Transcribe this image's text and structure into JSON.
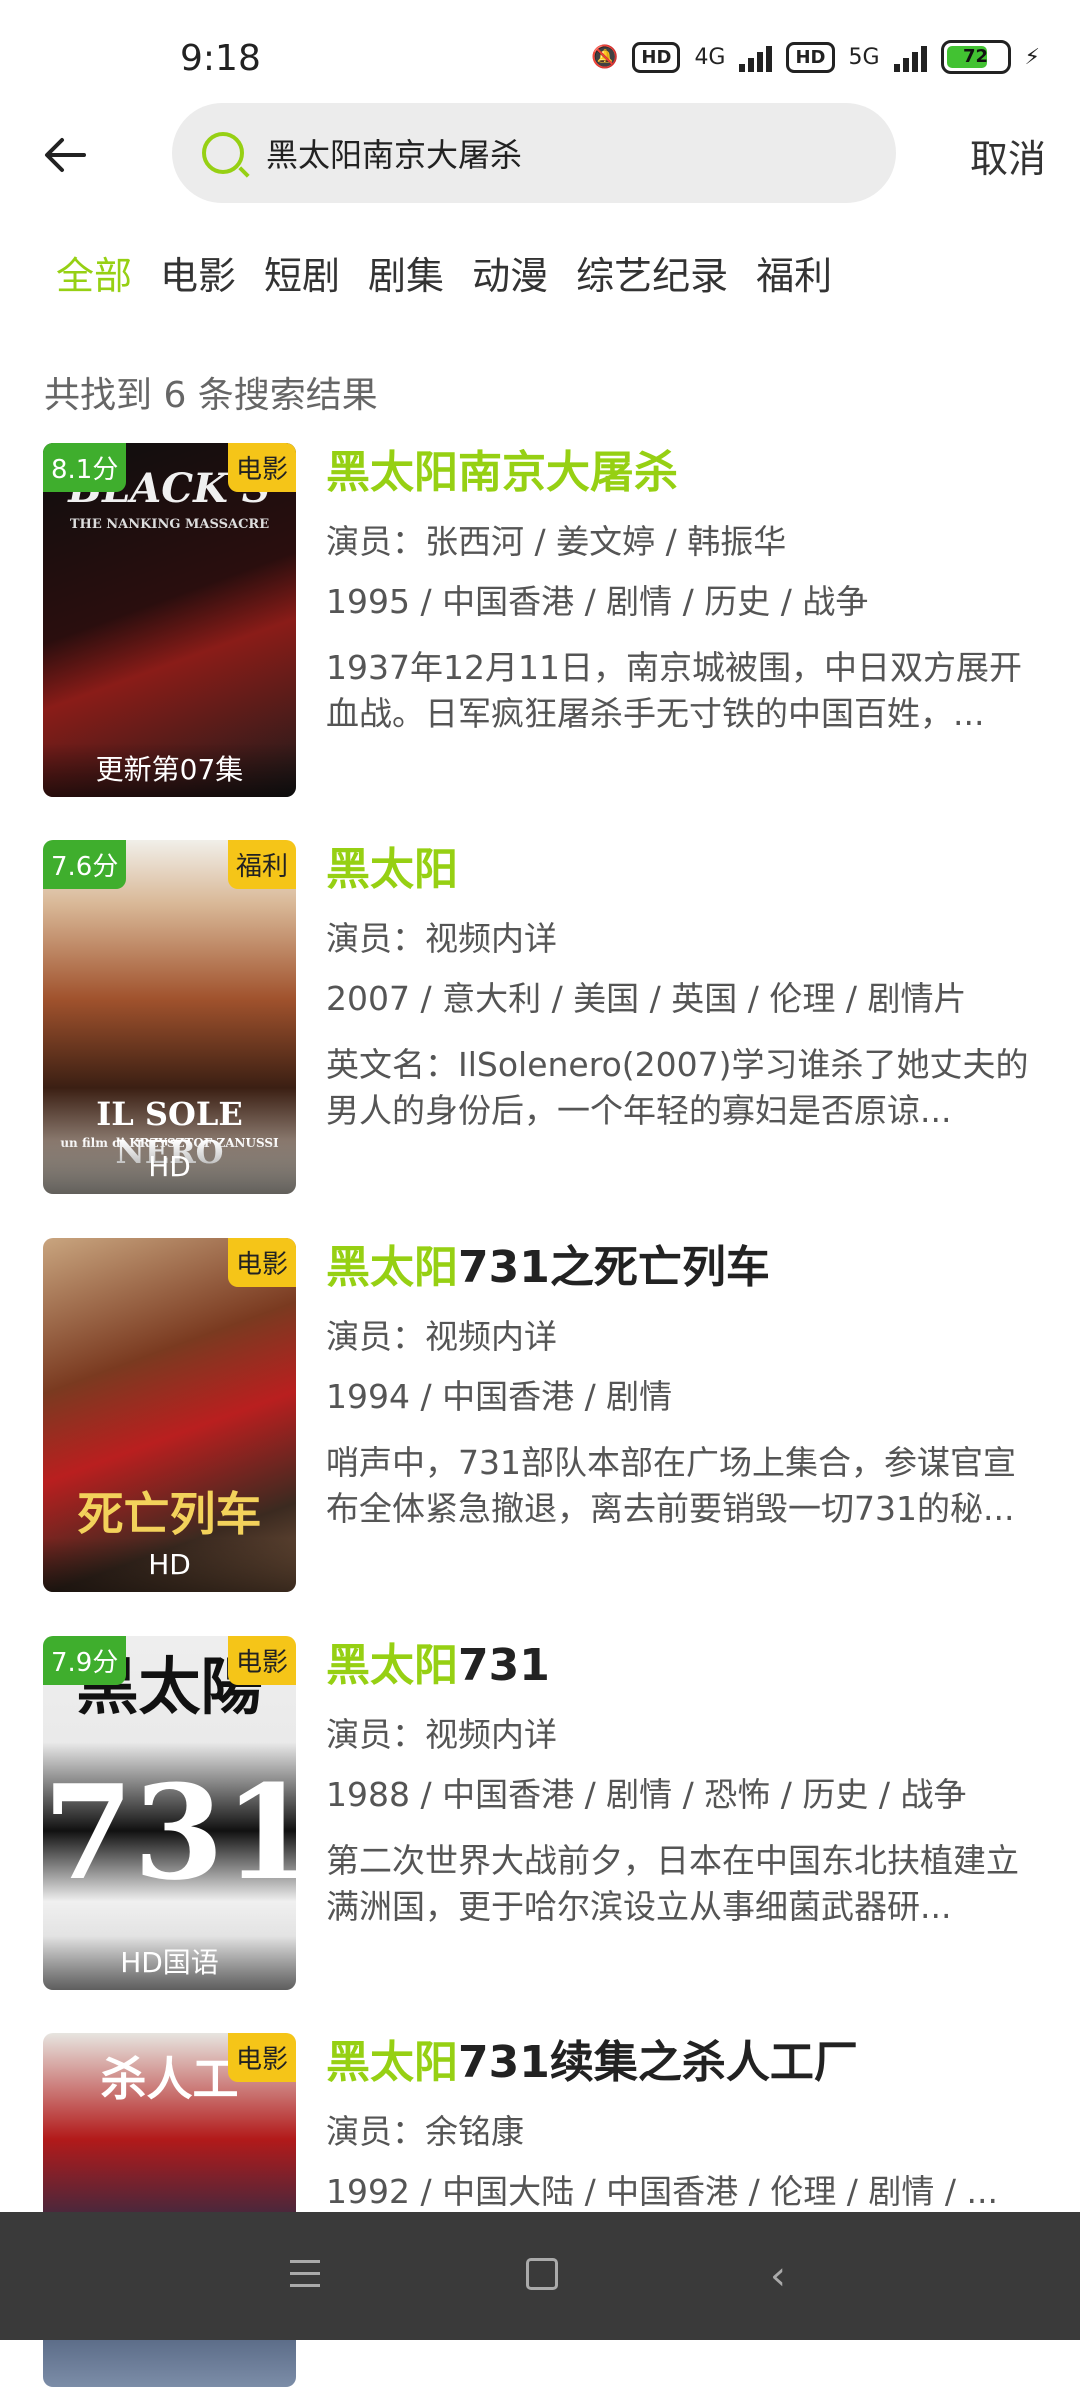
{
  "status": {
    "time": "9:18",
    "net1": "4G",
    "net2": "5G",
    "hd1": "HD",
    "hd2": "HD",
    "battery": "72"
  },
  "header": {
    "search_text": "黑太阳南京大屠杀",
    "cancel_label": "取消"
  },
  "tabs": [
    "全部",
    "电影",
    "短剧",
    "剧集",
    "动漫",
    "综艺纪录",
    "福利"
  ],
  "result_count": "共找到 6 条搜索结果",
  "results": [
    {
      "score": "8.1分",
      "tag": "电影",
      "badge": "更新第07集",
      "art_top": "BLACK S",
      "art_sub": "THE NANKING MASSACRE",
      "title_hl": "黑太阳南京大屠杀",
      "title_rest": "",
      "cast": "演员：张西河 / 姜文婷 / 韩振华",
      "meta": "1995 / 中国香港 / 剧情 / 历史 / 战争",
      "desc": "1937年12月11日，南京城被围，中日双方展开血战。日军疯狂屠杀手无寸铁的中国百姓，..."
    },
    {
      "score": "7.6分",
      "tag": "福利",
      "badge": "HD",
      "art_top": "IL SOLE NERO",
      "art_sub": "un film di KRZYSZTOF ZANUSSI",
      "title_hl": "黑太阳",
      "title_rest": "",
      "cast": "演员：视频内详",
      "meta": "2007 / 意大利 / 美国 / 英国 / 伦理 / 剧情片",
      "desc": "英文名：IlSolenero(2007)学习谁杀了她丈夫的男人的身份后，一个年轻的寡妇是否原谅..."
    },
    {
      "score": "",
      "tag": "电影",
      "badge": "HD",
      "art_top": "死亡列车",
      "art_sub": "",
      "title_hl": "黑太阳",
      "title_rest": "731之死亡列车",
      "cast": "演员：视频内详",
      "meta": "1994 / 中国香港 / 剧情",
      "desc": "哨声中，731部队本部在广场上集合，参谋官宣布全体紧急撤退，离去前要销毁一切731的秘..."
    },
    {
      "score": "7.9分",
      "tag": "电影",
      "badge": "HD国语",
      "art_top": "黑太陽",
      "art_sub": "731",
      "title_hl": "黑太阳",
      "title_rest": "731",
      "cast": "演员：视频内详",
      "meta": "1988 / 中国香港 / 剧情 / 恐怖 / 历史 / 战争",
      "desc": "第二次世界大战前夕，日本在中国东北扶植建立满洲国，更于哈尔滨设立从事细菌武器研..."
    },
    {
      "score": "",
      "tag": "电影",
      "badge": "",
      "art_top": "杀人工",
      "art_sub": "",
      "title_hl": "黑太阳",
      "title_rest": "731续集之杀人工厂",
      "cast": "演员：余铭康",
      "meta": "1992 / 中国大陆 / 中国香港 / 伦理 / 剧情 / ...",
      "desc": ""
    }
  ]
}
